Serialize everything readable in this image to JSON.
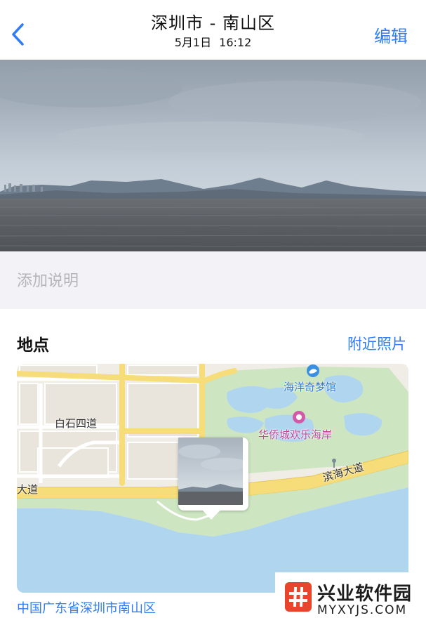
{
  "header": {
    "title": "深圳市 - 南山区",
    "subtitle": "5月1日  16:12",
    "edit_label": "编辑",
    "back_icon": "chevron-left-icon"
  },
  "caption": {
    "placeholder": "添加说明",
    "value": ""
  },
  "location": {
    "title": "地点",
    "nearby_label": "附近照片",
    "address": "中国广东省深圳市南山区",
    "map": {
      "labels": {
        "road_baishi": "白石四道",
        "road_dadao": "大道",
        "road_binhai": "滨海大道",
        "poi_aquarium": "海洋奇梦馆",
        "poi_park": "华侨城欢乐海岸"
      }
    }
  },
  "watermark": {
    "brand": "兴业软件园",
    "url": "MYXYJS.COM"
  },
  "colors": {
    "accent": "#2f7cf6",
    "caption_bg": "#f2f2f7",
    "water": "#b0d6ef",
    "park": "#cde6c1",
    "road": "#f6dd7a"
  }
}
